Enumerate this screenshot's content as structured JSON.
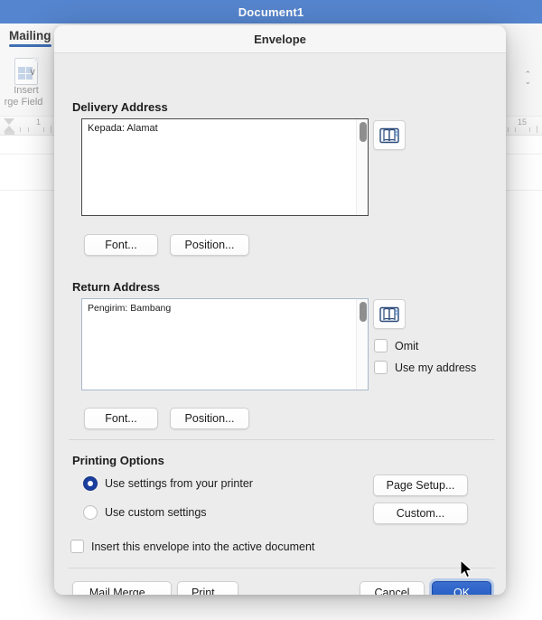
{
  "app": {
    "window_title": "Document1",
    "ribbon": {
      "active_tab": "Mailing",
      "insert_merge_field": {
        "icon": "document-grid-icon",
        "label_line1": "Insert",
        "label_line2": "rge Field",
        "chevron": "∨"
      }
    },
    "ruler": {
      "left_mark": "1",
      "right_mark": "15"
    },
    "spin_control": {
      "up": "⌃",
      "down": "⌄"
    }
  },
  "dialog": {
    "title": "Envelope",
    "delivery": {
      "heading": "Delivery Address",
      "value": "Kepada: Alamat",
      "placeholder": "",
      "address_book_icon": "address-book-icon",
      "font_button": "Font...",
      "position_button": "Position..."
    },
    "return": {
      "heading": "Return Address",
      "value": "Pengirim: Bambang",
      "placeholder": "",
      "address_book_icon": "address-book-icon",
      "font_button": "Font...",
      "position_button": "Position...",
      "omit_label": "Omit",
      "omit_checked": false,
      "use_my_address_label": "Use my address",
      "use_my_address_checked": false
    },
    "printing": {
      "heading": "Printing Options",
      "option_printer_label": "Use settings from your printer",
      "option_printer_selected": true,
      "option_custom_label": "Use custom settings",
      "option_custom_selected": false,
      "page_setup_button": "Page Setup...",
      "custom_button": "Custom...",
      "insert_envelope_label": "Insert this envelope into the active document",
      "insert_envelope_checked": false
    },
    "footer": {
      "mail_merge_button": "Mail Merge...",
      "print_button": "Print...",
      "cancel_button": "Cancel",
      "ok_button": "OK"
    }
  },
  "colors": {
    "titlebar_blue": "#5585ce",
    "primary_button_blue": "#1f57bd",
    "radio_selected_blue": "#1b3f9e",
    "tab_underline": "#3f6fb5"
  }
}
